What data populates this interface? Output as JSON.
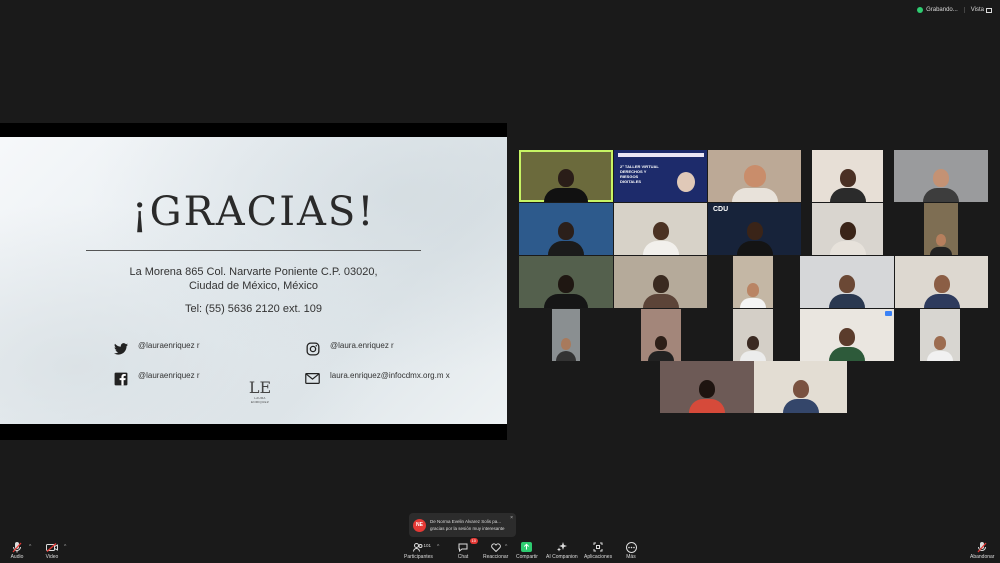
{
  "status": {
    "recording_label": "Grabando...",
    "view_label": "Vista"
  },
  "slide": {
    "title": "¡GRACIAS!",
    "address_line1": "La Morena 865 Col. Narvarte Poniente C.P. 03020,",
    "address_line2": "Ciudad de México, México",
    "phone": "Tel: (55) 5636 2120 ext. 109",
    "twitter": "@lauraenriquez r",
    "instagram": "@laura.enriquez r",
    "facebook": "@lauraenriquez r",
    "email": "laura.enriquez@infocdmx.org.m x",
    "logo_letters": "LE",
    "logo_caption": "LAURA ENRIQUEZ"
  },
  "poster": {
    "title_line1": "2° TALLER VIRTUAL",
    "title_line2": "DERECHOS Y RIESGOS",
    "title_line3": "DIGITALES"
  },
  "tile3_text": "CDU",
  "chat_toast": {
    "avatar_initials": "NE",
    "line1": "De Norma Evelin Alvarez Solis pa...",
    "line2": "gracias por la sesión muy interesante",
    "close": "×"
  },
  "toolbar": {
    "audio": "Audio",
    "video": "Video",
    "participants": "Participantes",
    "participant_count": "101",
    "chat": "Chat",
    "chat_badge": "10",
    "react": "Reaccionar",
    "share": "Compartir",
    "ai": "AI Companion",
    "apps": "Aplicaciones",
    "more": "Más",
    "leave": "Abandonar"
  },
  "colors": {
    "background": "#1a1a1a",
    "speaking_outline": "#c7f464",
    "share_green": "#2ecc71",
    "badge_red": "#e53935"
  }
}
